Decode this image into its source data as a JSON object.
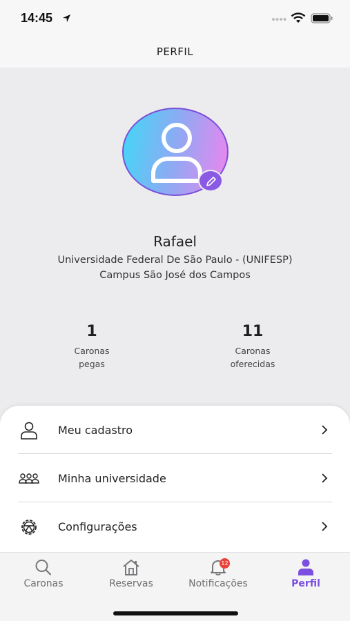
{
  "status_bar": {
    "time": "14:45"
  },
  "header": {
    "title": "PERFIL"
  },
  "profile": {
    "name": "Rafael",
    "university": "Universidade Federal De São Paulo - (UNIFESP)",
    "campus": "Campus São José dos Campos"
  },
  "stats": [
    {
      "value": "1",
      "label_line1": "Caronas",
      "label_line2": "pegas"
    },
    {
      "value": "11",
      "label_line1": "Caronas",
      "label_line2": "oferecidas"
    }
  ],
  "menu": [
    {
      "label": "Meu cadastro",
      "icon": "person-icon"
    },
    {
      "label": "Minha universidade",
      "icon": "group-icon"
    },
    {
      "label": "Configurações",
      "icon": "settings-icon"
    }
  ],
  "tabs": [
    {
      "label": "Caronas",
      "icon": "search-icon"
    },
    {
      "label": "Reservas",
      "icon": "home-icon"
    },
    {
      "label": "Notificações",
      "icon": "bell-icon",
      "badge": "12"
    },
    {
      "label": "Perfil",
      "icon": "person-icon",
      "active": true
    }
  ],
  "colors": {
    "accent": "#7b4fe0",
    "badge": "#e9423a",
    "avatar_gradient_start": "#3fd9f6",
    "avatar_gradient_end": "#ee84ee"
  }
}
